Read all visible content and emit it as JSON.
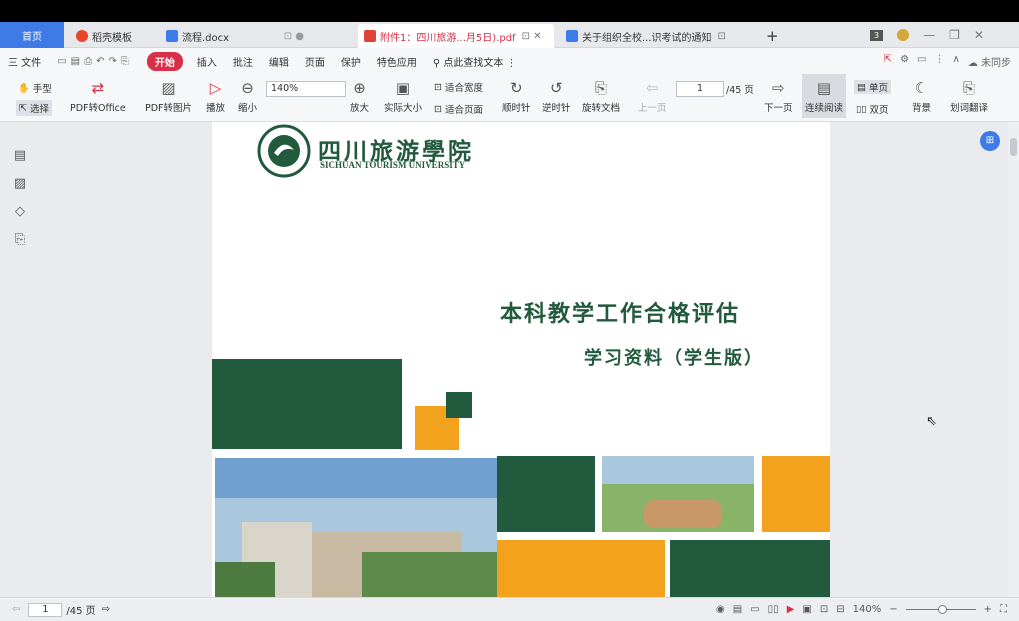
{
  "tabs": [
    {
      "label": "首页"
    },
    {
      "label": "稻壳模板"
    },
    {
      "label": "流程.docx"
    },
    {
      "label": "附件1：四川旅游...月5日).pdf"
    },
    {
      "label": "关于组织全校...识考试的通知"
    }
  ],
  "menu": {
    "file": "三 文件",
    "items": [
      "开始",
      "插入",
      "批注",
      "编辑",
      "页面",
      "保护",
      "特色应用"
    ],
    "search": "点此查找文本",
    "sync": "未同步"
  },
  "toolbar": {
    "hand": "手型",
    "select": "选择",
    "pdf_office": "PDF转Office",
    "pdf_image": "PDF转图片",
    "play": "播放",
    "zoom_out": "缩小",
    "zoom_value": "140%",
    "zoom_in": "放大",
    "actual": "实际大小",
    "fit_width": "适合宽度",
    "fit_page": "适合页面",
    "rotate_cw": "顺时针",
    "rotate_ccw": "逆时针",
    "rotate_doc": "旋转文档",
    "prev_page": "上一页",
    "page_value": "1",
    "page_total": "/45 页",
    "next_page": "下一页",
    "continuous": "连续阅读",
    "single": "单页",
    "double": "双页",
    "background": "背景",
    "translate": "划词翻译"
  },
  "document": {
    "logo_cn": "四川旅游學院",
    "logo_en": "SICHUAN TOURISM UNIVERSITY",
    "title": "本科教学工作合格评估",
    "subtitle": "学习资料（学生版）"
  },
  "status": {
    "page_value": "1",
    "page_total": "/45 页",
    "zoom": "140%"
  },
  "colors": {
    "green": "#215a3c",
    "orange": "#f3a21d",
    "accent": "#3f7be6",
    "red": "#d9304a"
  }
}
